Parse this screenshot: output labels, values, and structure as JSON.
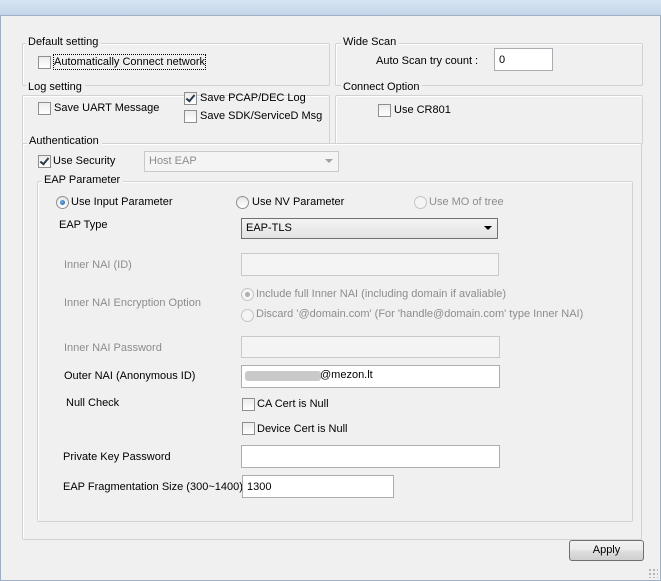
{
  "default_setting": {
    "title": "Default setting",
    "auto_connect": {
      "label": "Automatically Connect network",
      "checked": false
    }
  },
  "wide_scan": {
    "title": "Wide Scan",
    "auto_scan_label": "Auto Scan try count :",
    "auto_scan_value": "0"
  },
  "log_setting": {
    "title": "Log setting",
    "save_uart": {
      "label": "Save UART Message",
      "checked": false
    },
    "save_pcap": {
      "label": "Save PCAP/DEC Log",
      "checked": true
    },
    "save_sdk": {
      "label": "Save SDK/ServiceD Msg",
      "checked": false
    }
  },
  "connect_option": {
    "title": "Connect Option",
    "use_cr801": {
      "label": "Use CR801",
      "checked": false
    }
  },
  "authentication": {
    "title": "Authentication",
    "use_security": {
      "label": "Use Security",
      "checked": true
    },
    "security_combo": "Host EAP",
    "eap_parameter": {
      "title": "EAP Parameter",
      "source_radios": [
        {
          "label": "Use Input Parameter",
          "checked": true,
          "enabled": true
        },
        {
          "label": "Use NV Parameter",
          "checked": false,
          "enabled": true
        },
        {
          "label": "Use MO of tree",
          "checked": false,
          "enabled": false
        }
      ],
      "eap_type_label": "EAP Type",
      "eap_type_value": "EAP-TLS",
      "inner_nai_label": "Inner NAI (ID)",
      "inner_nai_value": "",
      "inner_nai_enc_label": "Inner NAI Encryption Option",
      "inner_nai_enc_opt1": "Include full Inner NAI (including domain if avaliable)",
      "inner_nai_enc_opt2": "Discard '@domain.com' (For 'handle@domain.com' type Inner NAI)",
      "inner_nai_password_label": "Inner NAI Password",
      "inner_nai_password_value": "",
      "outer_nai_label": "Outer NAI (Anonymous ID)",
      "outer_nai_value": "@mezon.lt",
      "null_check_label": "Null Check",
      "ca_cert_null": {
        "label": "CA Cert is Null",
        "checked": false
      },
      "device_cert_null": {
        "label": "Device Cert is Null",
        "checked": false
      },
      "private_key_label": "Private Key Password",
      "private_key_value": "",
      "frag_size_label": "EAP Fragmentation Size (300~1400)",
      "frag_size_value": "1300"
    }
  },
  "apply_button": "Apply"
}
